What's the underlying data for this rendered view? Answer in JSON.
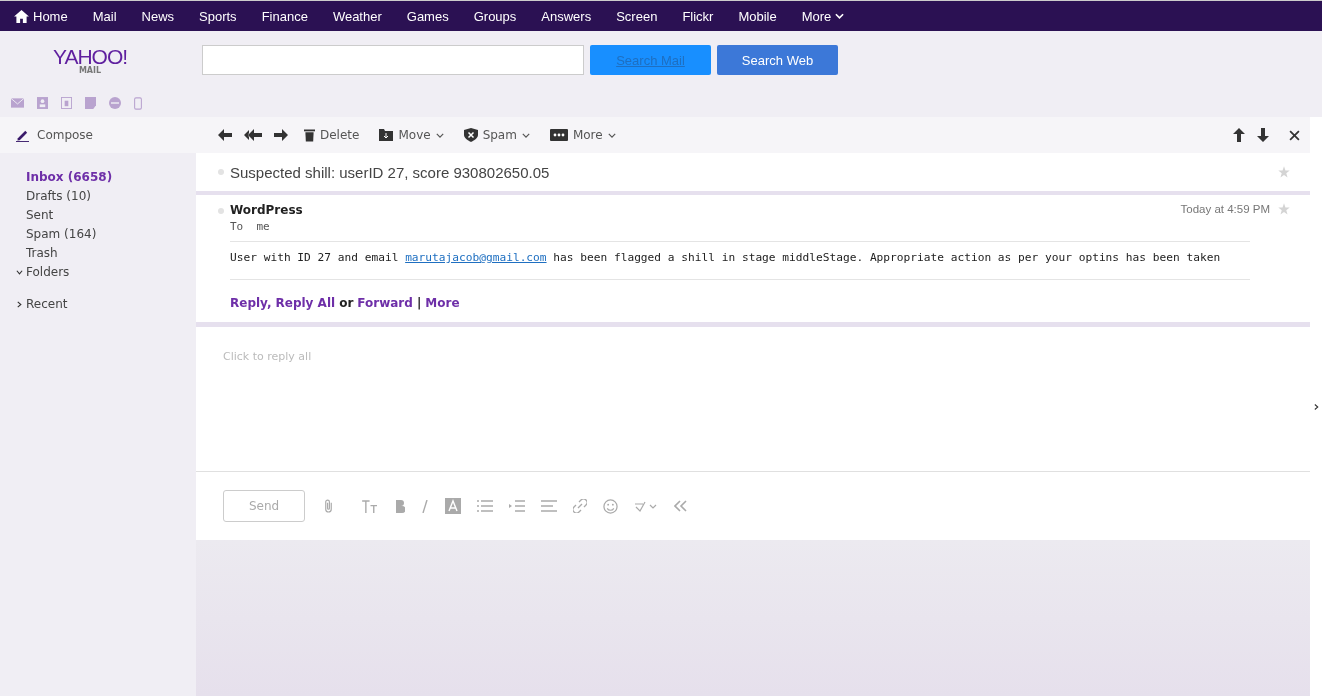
{
  "top_nav": [
    {
      "label": "Home",
      "kind": "home"
    },
    {
      "label": "Mail",
      "kind": "plain"
    },
    {
      "label": "News",
      "kind": "plain"
    },
    {
      "label": "Sports",
      "kind": "plain"
    },
    {
      "label": "Finance",
      "kind": "plain"
    },
    {
      "label": "Weather",
      "kind": "plain"
    },
    {
      "label": "Games",
      "kind": "plain"
    },
    {
      "label": "Groups",
      "kind": "plain"
    },
    {
      "label": "Answers",
      "kind": "plain"
    },
    {
      "label": "Screen",
      "kind": "plain"
    },
    {
      "label": "Flickr",
      "kind": "plain"
    },
    {
      "label": "Mobile",
      "kind": "plain"
    },
    {
      "label": "More",
      "kind": "menu"
    }
  ],
  "logo": {
    "name": "YAHOO!",
    "sub": "MAIL"
  },
  "search_buttons": [
    {
      "label": "Search Mail",
      "kind": "mail"
    },
    {
      "label": "Search Web",
      "kind": "web"
    }
  ],
  "compose": "Compose",
  "folders": [
    {
      "label": "Inbox (6658)",
      "selected": true
    },
    {
      "label": "Drafts (10)",
      "selected": false
    },
    {
      "label": "Sent",
      "selected": false
    },
    {
      "label": "Spam (164)",
      "selected": false
    },
    {
      "label": "Trash",
      "selected": false
    }
  ],
  "sections": [
    {
      "label": "Folders",
      "expanded": true
    },
    {
      "label": "Recent",
      "expanded": false
    }
  ],
  "toolbar": [
    {
      "label": "Delete",
      "kind": "delete"
    },
    {
      "label": "Move",
      "kind": "move"
    },
    {
      "label": "Spam",
      "kind": "spam"
    },
    {
      "label": "More",
      "kind": "more"
    }
  ],
  "subject": {
    "text": "Suspected shill: userID 27, score 930802650.05",
    "starred": false
  },
  "message": {
    "sender": "WordPress",
    "to": "To  me",
    "date": "Today at 4:59 PM",
    "starred": false,
    "body_before": "User with ID 27 and email ",
    "body_link": "marutajacob@gmail.com",
    "body_after": " has been flagged a shill in stage middleStage. Appropriate action as per your optins has been taken",
    "actions": [
      {
        "text": "Reply,",
        "kind": "link"
      },
      {
        "text": "Reply All",
        "kind": "link"
      },
      {
        "text": "or",
        "kind": "text"
      },
      {
        "text": "Forward",
        "kind": "link"
      },
      {
        "text": "|",
        "kind": "text"
      },
      {
        "text": "More",
        "kind": "link"
      }
    ]
  },
  "reply_placeholder": "Click to reply all",
  "send": "Send"
}
